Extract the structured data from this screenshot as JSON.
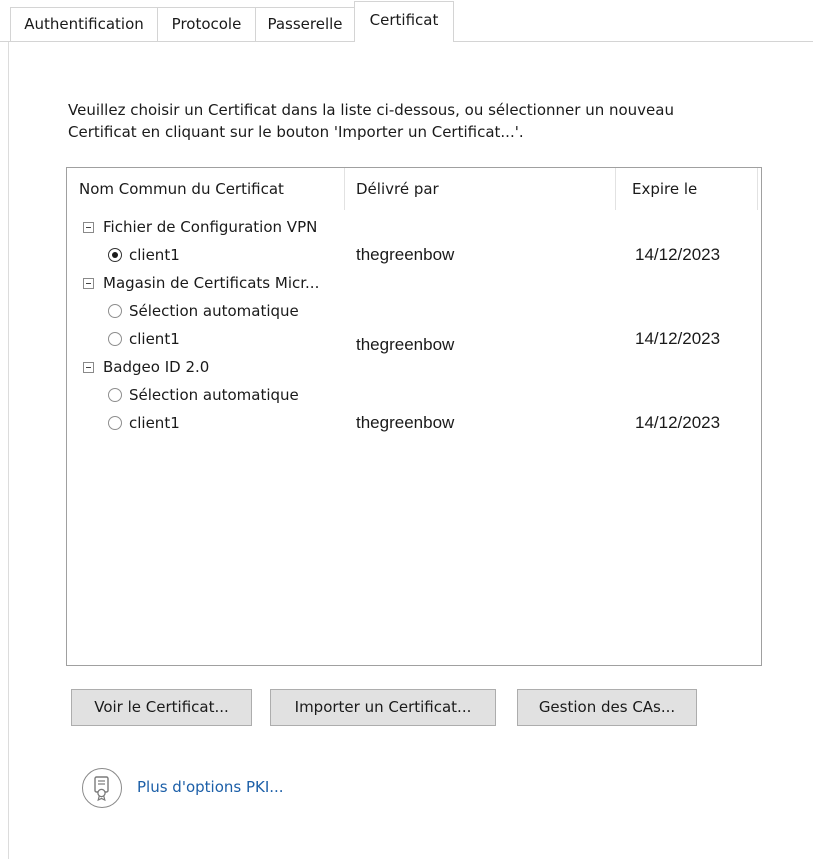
{
  "tabs": [
    {
      "label": "Authentification"
    },
    {
      "label": "Protocole"
    },
    {
      "label": "Passerelle"
    },
    {
      "label": "Certificat",
      "active": true
    }
  ],
  "intro": {
    "line1": "Veuillez choisir un Certificat dans la liste ci-dessous, ou sélectionner un nouveau",
    "line2": "Certificat en cliquant sur le bouton 'Importer un Certificat...'."
  },
  "list": {
    "columns": [
      "Nom Commun du Certificat",
      "Délivré par",
      "Expire le"
    ],
    "groups": [
      {
        "name": "Fichier de Configuration VPN",
        "items": [
          {
            "name": "client1",
            "issuer": "thegreenbow",
            "expires": "14/12/2023",
            "selected": true
          }
        ]
      },
      {
        "name": "Magasin de Certificats Micr...",
        "items": [
          {
            "name": "Sélection automatique",
            "issuer": "",
            "expires": "",
            "selected": false
          },
          {
            "name": "client1",
            "issuer": "thegreenbow",
            "expires": "14/12/2023",
            "selected": false
          }
        ]
      },
      {
        "name": "Badgeo ID 2.0",
        "items": [
          {
            "name": "Sélection automatique",
            "issuer": "",
            "expires": "",
            "selected": false
          },
          {
            "name": "client1",
            "issuer": "thegreenbow",
            "expires": "14/12/2023",
            "selected": false
          }
        ]
      }
    ]
  },
  "buttons": {
    "view": "Voir le Certificat...",
    "import": "Importer un Certificat...",
    "ca": "Gestion des CAs..."
  },
  "pki_link": "Plus d'options PKI...",
  "icons": {
    "pki": "certificate-icon"
  },
  "colors": {
    "link": "#1c5fa8",
    "button_bg": "#e1e1e1"
  }
}
